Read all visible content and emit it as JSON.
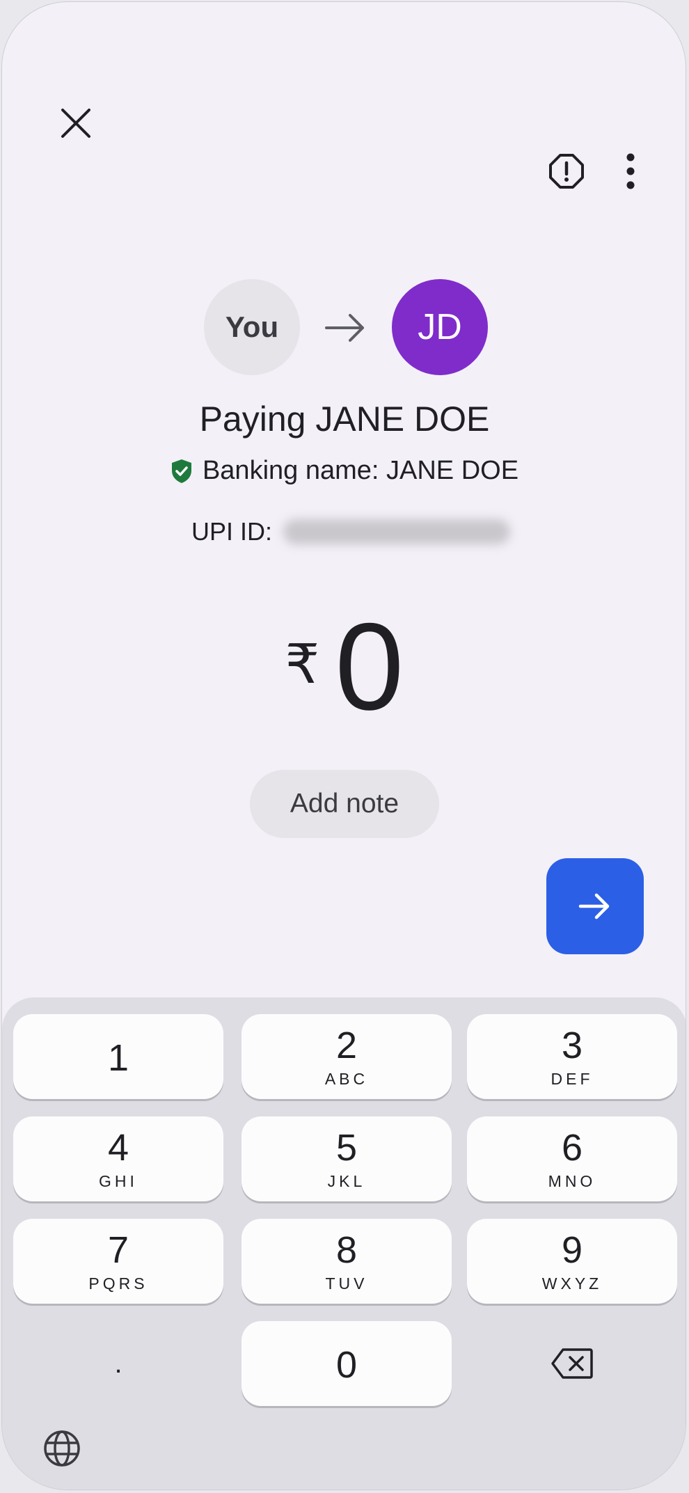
{
  "header": {
    "close_icon": "close-icon",
    "report_icon": "alert-octagon-icon",
    "more_icon": "more-vert-icon"
  },
  "participants": {
    "payer_label": "You",
    "payee_initials": "JD",
    "payee_color": "#7f2ccb",
    "arrow_icon": "arrow-right-icon"
  },
  "payee": {
    "paying_text": "Paying JANE DOE",
    "banking_name_text": "Banking name: JANE DOE",
    "verified_icon": "verified-shield-icon",
    "verified_color": "#1e7a3c",
    "upi_label": "UPI ID:"
  },
  "amount": {
    "currency_symbol": "₹",
    "value": "0"
  },
  "note_button_label": "Add note",
  "proceed": {
    "icon": "arrow-right-icon",
    "color": "#2b5fe6"
  },
  "keypad": {
    "keys": [
      {
        "digit": "1",
        "letters": ""
      },
      {
        "digit": "2",
        "letters": "ABC"
      },
      {
        "digit": "3",
        "letters": "DEF"
      },
      {
        "digit": "4",
        "letters": "GHI"
      },
      {
        "digit": "5",
        "letters": "JKL"
      },
      {
        "digit": "6",
        "letters": "MNO"
      },
      {
        "digit": "7",
        "letters": "PQRS"
      },
      {
        "digit": "8",
        "letters": "TUV"
      },
      {
        "digit": "9",
        "letters": "WXYZ"
      },
      {
        "digit": "0",
        "letters": ""
      }
    ],
    "decimal": ".",
    "backspace_icon": "backspace-icon",
    "language_icon": "globe-icon"
  }
}
